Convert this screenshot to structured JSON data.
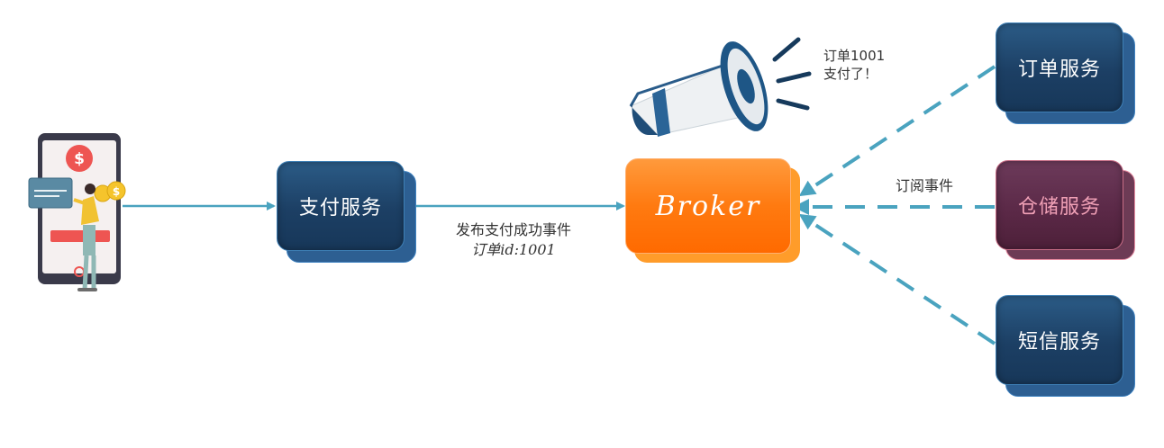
{
  "nodes": {
    "payment": "支付服务",
    "broker": "Broker",
    "order": "订单服务",
    "storage": "仓储服务",
    "sms": "短信服务"
  },
  "edges": {
    "publish_line1": "发布支付成功事件",
    "publish_line2": "订单id:1001",
    "subscribe": "订阅事件"
  },
  "announcement": {
    "line1": "订单1001",
    "line2": "支付了！"
  },
  "colors": {
    "service_blue": "#1c3f64",
    "storage_maroon": "#5a2846",
    "broker_orange": "#ff7a10",
    "arrow_teal": "#4aa3bf",
    "dashed_teal": "#4aa3bf"
  }
}
